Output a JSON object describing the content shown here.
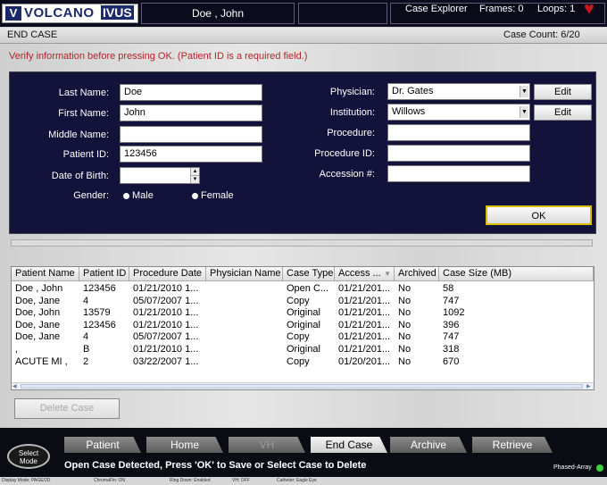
{
  "topbar": {
    "logo_text": "VOLCANO",
    "logo_ivus": "IVUS",
    "logo_mark": "V",
    "patient_name": "Doe , John",
    "case_explorer": "Case Explorer",
    "frames": "Frames: 0",
    "loops": "Loops: 1",
    "heart_icon": "heart-icon"
  },
  "header": {
    "title": "END CASE",
    "case_count": "Case Count: 6/20"
  },
  "verify_message": "Verify information before pressing OK. (Patient ID is a required field.)",
  "form": {
    "last_name": {
      "label": "Last Name:",
      "value": "Doe"
    },
    "first_name": {
      "label": "First Name:",
      "value": "John"
    },
    "middle_name": {
      "label": "Middle Name:",
      "value": ""
    },
    "patient_id": {
      "label": "Patient ID:",
      "value": "123456"
    },
    "dob": {
      "label": "Date of Birth:",
      "value": ""
    },
    "gender": {
      "label": "Gender:",
      "male": "Male",
      "female": "Female"
    },
    "physician": {
      "label": "Physician:",
      "value": "Dr. Gates",
      "edit": "Edit"
    },
    "institution": {
      "label": "Institution:",
      "value": "Willows",
      "edit": "Edit"
    },
    "procedure": {
      "label": "Procedure:",
      "value": ""
    },
    "procedure_id": {
      "label": "Procedure ID:",
      "value": ""
    },
    "accession": {
      "label": "Accession #:",
      "value": ""
    },
    "ok": "OK"
  },
  "table": {
    "columns": [
      "Patient Name",
      "Patient ID",
      "Procedure Date",
      "Physician Name",
      "Case Type",
      "Access ...",
      "Archived",
      "Case Size (MB)"
    ],
    "rows": [
      [
        "Doe , John",
        "123456",
        "01/21/2010 1...",
        "",
        "Open C...",
        "01/21/201...",
        "No",
        "58"
      ],
      [
        "Doe, Jane",
        "4",
        "05/07/2007 1...",
        "",
        "Copy",
        "01/21/201...",
        "No",
        "747"
      ],
      [
        "Doe, John",
        "13579",
        "01/21/2010 1...",
        "",
        "Original",
        "01/21/201...",
        "No",
        "1092"
      ],
      [
        "Doe, Jane",
        "123456",
        "01/21/2010 1...",
        "",
        "Original",
        "01/21/201...",
        "No",
        "396"
      ],
      [
        "Doe, Jane",
        "4",
        "05/07/2007 1...",
        "",
        "Copy",
        "01/21/201...",
        "No",
        "747"
      ],
      [
        ",",
        "B",
        "01/21/2010 1...",
        "",
        "Original",
        "01/21/201...",
        "No",
        "318"
      ],
      [
        "ACUTE MI ,",
        "2",
        "03/22/2007 1...",
        "",
        "Copy",
        "01/20/201...",
        "No",
        "670"
      ]
    ]
  },
  "delete_case": "Delete Case",
  "nav": {
    "select_mode": "Select Mode",
    "tabs": [
      "Patient",
      "Home",
      "VH",
      "End Case",
      "Archive",
      "Retrieve"
    ],
    "active": "End Case"
  },
  "status_message": "Open Case Detected, Press 'OK' to Save or Select Case to Delete",
  "phased_array": "Phased-Array",
  "statusbar": {
    "item1": "Display Mode: PAGE/2D",
    "item2": "ChromaFlo: ON",
    "item3": "Ring Down: Enabled",
    "item4": "VH: OFF",
    "item5": "Catheter: Eagle Eye"
  }
}
